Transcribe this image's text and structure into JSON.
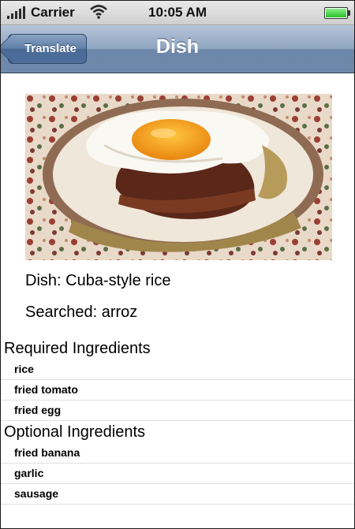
{
  "status_bar": {
    "carrier": "Carrier",
    "time": "10:05 AM",
    "battery_level": 1.0
  },
  "nav_bar": {
    "back_label": "Translate",
    "title": "Dish"
  },
  "dish": {
    "label": "Dish: Cuba-style rice",
    "searched": "Searched: arroz"
  },
  "required": {
    "header": "Required Ingredients",
    "items": [
      "rice",
      "fried tomato",
      "fried egg"
    ]
  },
  "optional": {
    "header": "Optional Ingredients",
    "items": [
      "fried banana",
      "garlic",
      "sausage"
    ]
  },
  "colors": {
    "nav_bar": "#8ea4c0",
    "back_button": "#5f7ea7",
    "egg_yolk": "#f6a51a"
  },
  "icons": [
    "signal-icon",
    "wifi-icon",
    "battery-icon",
    "dish-photo"
  ]
}
